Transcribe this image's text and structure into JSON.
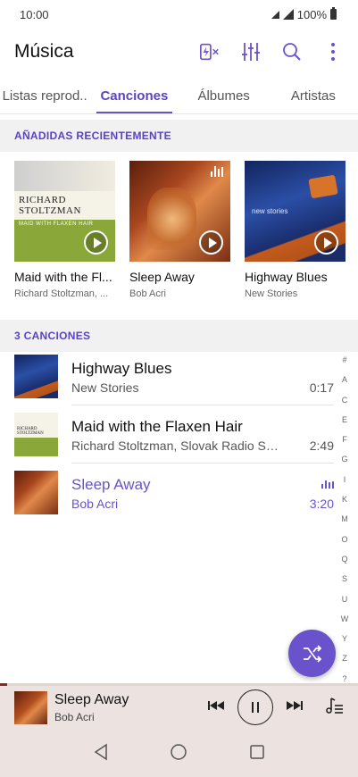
{
  "status_bar": {
    "time": "10:00",
    "battery": "100%"
  },
  "header": {
    "title": "Música",
    "icons": [
      "sleep-timer-icon",
      "equalizer-icon",
      "search-icon",
      "more-options-icon"
    ]
  },
  "tabs": [
    {
      "label": "Listas reprod..",
      "active": false
    },
    {
      "label": "Canciones",
      "active": true
    },
    {
      "label": "Álbumes",
      "active": false
    },
    {
      "label": "Artistas",
      "active": false
    }
  ],
  "recent": {
    "heading": "AÑADIDAS RECIENTEMENTE",
    "albums": [
      {
        "title": "Maid with the Fl...",
        "artist": "Richard Stoltzman, ...",
        "art": "richard-stoltzman-cover",
        "art_text_name": "RICHARD STOLTZMAN",
        "art_text_tag": "MAID WITH FLAXEN HAIR"
      },
      {
        "title": "Sleep Away",
        "artist": "Bob Acri",
        "art": "sleep-away-cover",
        "now_playing": true
      },
      {
        "title": "Highway Blues",
        "artist": "New Stories",
        "art": "highway-blues-cover",
        "art_text": "new stories"
      }
    ]
  },
  "songs": {
    "heading": "3 CANCIONES",
    "items": [
      {
        "title": "Highway Blues",
        "artist": "New Stories",
        "duration": "0:17",
        "playing": false
      },
      {
        "title": "Maid with the Flaxen Hair",
        "artist": "Richard Stoltzman, Slovak Radio Symp...",
        "duration": "2:49",
        "playing": false
      },
      {
        "title": "Sleep Away",
        "artist": "Bob Acri",
        "duration": "3:20",
        "playing": true
      }
    ]
  },
  "index_letters": [
    "#",
    "A",
    "C",
    "E",
    "F",
    "G",
    "I",
    "K",
    "M",
    "O",
    "Q",
    "S",
    "U",
    "W",
    "Y",
    "Z",
    "?"
  ],
  "mini_player": {
    "title": "Sleep Away",
    "artist": "Bob Acri",
    "progress": 0.02
  },
  "colors": {
    "accent": "#6a52cc",
    "player_bg": "#ece2df"
  }
}
